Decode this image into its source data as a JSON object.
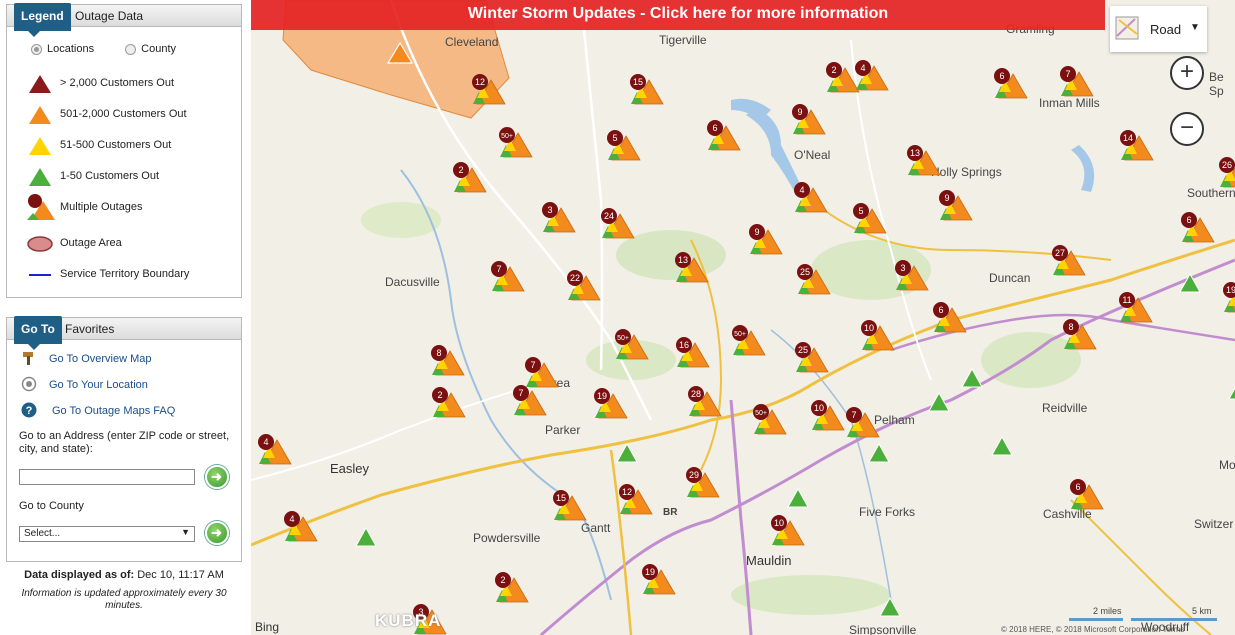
{
  "legend_panel": {
    "tab_active": "Legend",
    "tab_other": "Outage Data",
    "view_options": [
      {
        "label": "Locations",
        "selected": true
      },
      {
        "label": "County",
        "selected": false
      }
    ],
    "items": [
      {
        "label": "> 2,000 Customers Out",
        "icon": "dark-red-triangle-icon",
        "color": "#8b1a1a"
      },
      {
        "label": "501-2,000 Customers Out",
        "icon": "orange-triangle-icon",
        "color": "#f28a1e"
      },
      {
        "label": "51-500 Customers Out",
        "icon": "yellow-triangle-icon",
        "color": "#ffd400"
      },
      {
        "label": "1-50 Customers Out",
        "icon": "green-triangle-icon",
        "color": "#4caf3c"
      },
      {
        "label": "Multiple Outages",
        "icon": "multiple-outages-icon",
        "color": "#7a1010"
      },
      {
        "label": "Outage Area",
        "icon": "outage-area-icon",
        "color": "#d88c8c"
      },
      {
        "label": "Service Territory Boundary",
        "icon": "boundary-line-icon",
        "color": "#1a22c8"
      }
    ]
  },
  "goto_panel": {
    "tab_active": "Go To",
    "tab_other": "Favorites",
    "links": [
      {
        "label": "Go To Overview Map",
        "icon": "hammer-icon"
      },
      {
        "label": "Go To Your Location",
        "icon": "location-icon"
      },
      {
        "label": "Go To Outage Maps FAQ",
        "icon": "help-icon"
      }
    ],
    "address_label": "Go to an Address (enter ZIP code or street, city, and state):",
    "address_value": "",
    "county_label": "Go to County",
    "county_select": "Select..."
  },
  "footer": {
    "data_label": "Data displayed as of:",
    "data_time": "Dec 10, 11:17 AM",
    "update_note": "Information is updated approximately every 30 minutes."
  },
  "map": {
    "banner": "Winter Storm Updates - Click here for more information",
    "road_label": "Road",
    "zoom_in": "+",
    "zoom_out": "−",
    "scale_miles": "2 miles",
    "scale_km": "5 km",
    "bing": "Bing",
    "kubra": "KUBRA",
    "copyright": "© 2018 HERE, © 2018 Microsoft Corporation  Terms",
    "places": [
      "Cleveland",
      "Tigerville",
      "Gramling",
      "Inman Mills",
      "O'Neal",
      "Holly Springs",
      "Southern",
      "Dacusville",
      "Duncan",
      "Berea",
      "Parker",
      "Pelham",
      "Reidville",
      "Easley",
      "Powdersville",
      "Gantt",
      "BR",
      "Mauldin",
      "Five Forks",
      "Cashville",
      "Switzer",
      "Simpsonville",
      "Woodruff",
      "Be",
      "Sp",
      "Mo"
    ],
    "markers": [
      {
        "label": "12",
        "type": "multi"
      },
      {
        "label": "15",
        "type": "multi"
      },
      {
        "label": "6",
        "type": "multi"
      },
      {
        "label": "9",
        "type": "multi"
      },
      {
        "label": "2",
        "type": "multi"
      },
      {
        "label": "4",
        "type": "multi"
      },
      {
        "label": "6",
        "type": "multi"
      },
      {
        "label": "7",
        "type": "multi"
      },
      {
        "label": "50+",
        "type": "multi"
      },
      {
        "label": "5",
        "type": "multi"
      },
      {
        "label": "14",
        "type": "multi"
      },
      {
        "label": "13",
        "type": "multi"
      },
      {
        "label": "2",
        "type": "multi"
      },
      {
        "label": "4",
        "type": "multi"
      },
      {
        "label": "9",
        "type": "multi"
      },
      {
        "label": "26",
        "type": "multi"
      },
      {
        "label": "3",
        "type": "multi"
      },
      {
        "label": "24",
        "type": "multi"
      },
      {
        "label": "5",
        "type": "multi"
      },
      {
        "label": "6",
        "type": "multi"
      },
      {
        "label": "9",
        "type": "multi"
      },
      {
        "label": "13",
        "type": "multi"
      },
      {
        "label": "27",
        "type": "multi"
      },
      {
        "label": "7",
        "type": "multi"
      },
      {
        "label": "22",
        "type": "multi"
      },
      {
        "label": "25",
        "type": "multi"
      },
      {
        "label": "3",
        "type": "multi"
      },
      {
        "label": "19",
        "type": "multi"
      },
      {
        "label": "11",
        "type": "multi"
      },
      {
        "label": "6",
        "type": "multi"
      },
      {
        "label": "8",
        "type": "multi"
      },
      {
        "label": "50+",
        "type": "multi"
      },
      {
        "label": "16",
        "type": "multi"
      },
      {
        "label": "50+",
        "type": "multi"
      },
      {
        "label": "10",
        "type": "multi"
      },
      {
        "label": "8",
        "type": "multi"
      },
      {
        "label": "7",
        "type": "multi"
      },
      {
        "label": "25",
        "type": "multi"
      },
      {
        "label": "2",
        "type": "multi"
      },
      {
        "label": "7",
        "type": "multi"
      },
      {
        "label": "19",
        "type": "multi"
      },
      {
        "label": "28",
        "type": "multi"
      },
      {
        "label": "50+",
        "type": "multi"
      },
      {
        "label": "10",
        "type": "multi"
      },
      {
        "label": "7",
        "type": "multi"
      },
      {
        "label": "4",
        "type": "multi"
      },
      {
        "label": "29",
        "type": "multi"
      },
      {
        "label": "6",
        "type": "multi"
      },
      {
        "label": "4",
        "type": "multi"
      },
      {
        "label": "15",
        "type": "multi"
      },
      {
        "label": "12",
        "type": "multi"
      },
      {
        "label": "10",
        "type": "multi"
      },
      {
        "label": "2",
        "type": "multi"
      },
      {
        "label": "19",
        "type": "multi"
      },
      {
        "label": "3",
        "type": "multi"
      },
      {
        "label": "3",
        "type": "multi"
      },
      {
        "label": "2",
        "type": "multi"
      },
      {
        "label": "19",
        "type": "multi"
      },
      {
        "label": "7",
        "type": "multi"
      }
    ]
  }
}
